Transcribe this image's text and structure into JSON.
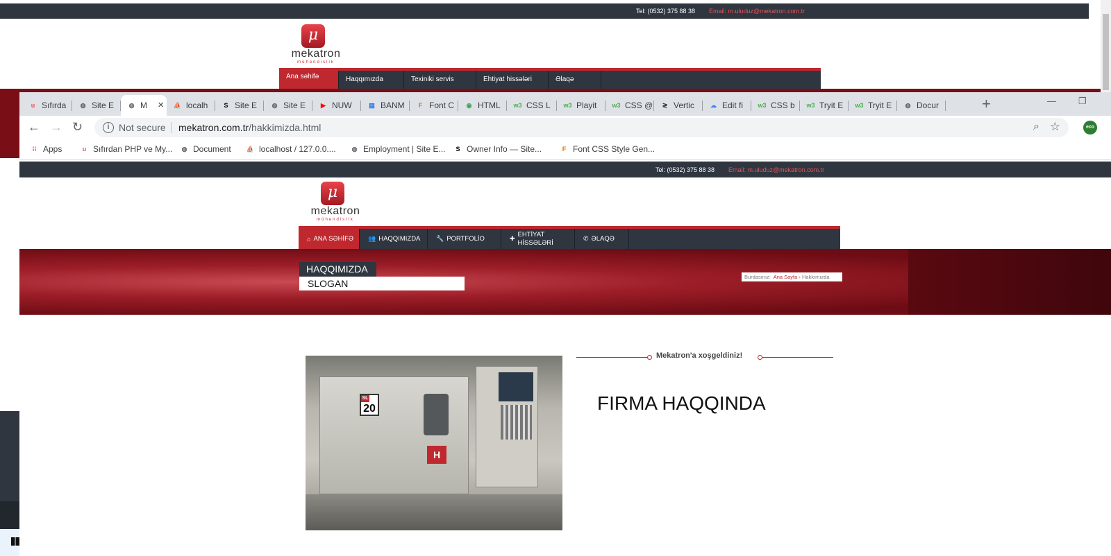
{
  "bg_site": {
    "tel": "Tel: (0532) 375 88 38",
    "email": "Email: m.uluduz@mekatron.com.tr",
    "nav": [
      "Ana səhifə",
      "Haqqımızda",
      "Texiniki servis",
      "Ehtiyat hissələri",
      "Əlaqə"
    ]
  },
  "browser": {
    "tabs": [
      {
        "label": "Sıfırda",
        "icon": "udemy-icon",
        "color": "#ea5252"
      },
      {
        "label": "Site E",
        "icon": "globe-icon",
        "color": "#5f6368"
      },
      {
        "label": "M",
        "icon": "globe-icon",
        "color": "#5f6368",
        "active": true
      },
      {
        "label": "localh",
        "icon": "phpmyadmin-icon",
        "color": "#f29111"
      },
      {
        "label": "Site E",
        "icon": "sei-icon",
        "color": "#000000"
      },
      {
        "label": "Site E",
        "icon": "globe-icon",
        "color": "#5f6368"
      },
      {
        "label": "NUW",
        "icon": "youtube-icon",
        "color": "#ff0000"
      },
      {
        "label": "BANM",
        "icon": "document-icon",
        "color": "#1a73e8"
      },
      {
        "label": "Font C",
        "icon": "font-css-icon",
        "color": "#e8710a"
      },
      {
        "label": "HTML",
        "icon": "html-icon",
        "color": "#34a853"
      },
      {
        "label": "CSS L",
        "icon": "w3-icon",
        "color": "#4caf50"
      },
      {
        "label": "Playit",
        "icon": "w3-icon",
        "color": "#4caf50"
      },
      {
        "label": "CSS @",
        "icon": "w3-icon",
        "color": "#4caf50"
      },
      {
        "label": "Vertic",
        "icon": "code-icon",
        "color": "#333333"
      },
      {
        "label": "Edit fi",
        "icon": "cloud-icon",
        "color": "#4285f4"
      },
      {
        "label": "CSS b",
        "icon": "w3-icon",
        "color": "#4caf50"
      },
      {
        "label": "Tryit E",
        "icon": "w3-icon",
        "color": "#4caf50"
      },
      {
        "label": "Tryit E",
        "icon": "w3-icon",
        "color": "#4caf50"
      },
      {
        "label": "Docur",
        "icon": "globe-icon",
        "color": "#5f6368"
      }
    ],
    "security": "Not secure",
    "url_host": "mekatron.com.tr",
    "url_path": "/hakkimizda.html",
    "extension_label": "eco",
    "bookmarks": [
      {
        "label": "Apps",
        "icon": "apps-grid-icon"
      },
      {
        "label": "Sıfırdan PHP ve My...",
        "icon": "udemy-icon"
      },
      {
        "label": "Document",
        "icon": "globe-icon"
      },
      {
        "label": "localhost / 127.0.0....",
        "icon": "phpmyadmin-icon"
      },
      {
        "label": "Employment | Site E...",
        "icon": "globe-icon"
      },
      {
        "label": "Owner Info — Site...",
        "icon": "sei-icon"
      },
      {
        "label": "Font CSS Style Gen...",
        "icon": "font-css-icon"
      }
    ]
  },
  "site": {
    "tel": "Tel: (0532) 375 88 38",
    "email": "Email: m.uluduz@mekatron.com.tr",
    "logo": {
      "mark": "μ",
      "name": "mekatron",
      "sub": "mühendislik"
    },
    "nav": [
      {
        "label": "ANA SƏHİFƏ",
        "icon": "home-icon",
        "active": true
      },
      {
        "label": "HAQQIMIZDA",
        "icon": "users-icon"
      },
      {
        "label": "PORTFOLİO",
        "icon": "wrench-icon"
      },
      {
        "label": "EHTİYAT HİSSƏLƏRİ",
        "icon": "puzzle-icon"
      },
      {
        "label": "ƏLAQƏ",
        "icon": "phone-icon"
      }
    ],
    "banner": {
      "title": "HAQQIMIZDA",
      "slogan": "SLOGAN",
      "breadcrumb_prefix": "Burdasınız:",
      "breadcrumb_home": "Ana Sayfa",
      "breadcrumb_sep": "›",
      "breadcrumb_current": "Hakkımızda"
    },
    "welcome": "Mekatron'a xoşgeldiniz!",
    "heading": "FIRMA HAQQINDA",
    "machine_badge": "20",
    "machine_badge_tag": "SL",
    "machine_logo": "H"
  },
  "colors": {
    "brand_red": "#c0282f",
    "dark": "#2f3640"
  }
}
